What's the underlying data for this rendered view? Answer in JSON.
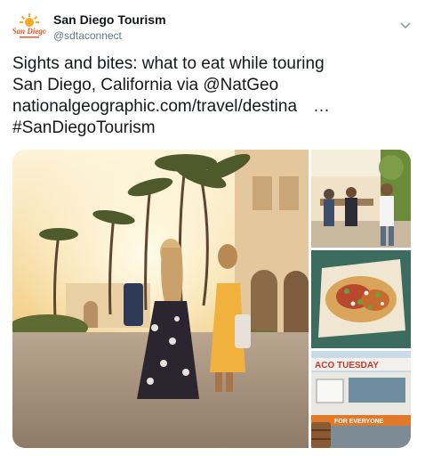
{
  "account": {
    "display_name": "San Diego Tourism",
    "handle": "@sdtaconnect",
    "avatar_text": "San Diego"
  },
  "tweet": {
    "line1": "Sights and bites: what to eat while touring",
    "line2": "San Diego, California via @NatGeo",
    "link": "nationalgeographic.com/travel/destina",
    "ellipsis": "…",
    "hashtag": "#SanDiegoTourism"
  },
  "media": {
    "sign_text": "ACO TUESDAY",
    "truck_text": "FOR EVERYONE"
  },
  "icons": {
    "caret": "chevron-down-icon"
  },
  "colors": {
    "text": "#14171a",
    "muted": "#657786",
    "brand_orange": "#f39c1e"
  }
}
